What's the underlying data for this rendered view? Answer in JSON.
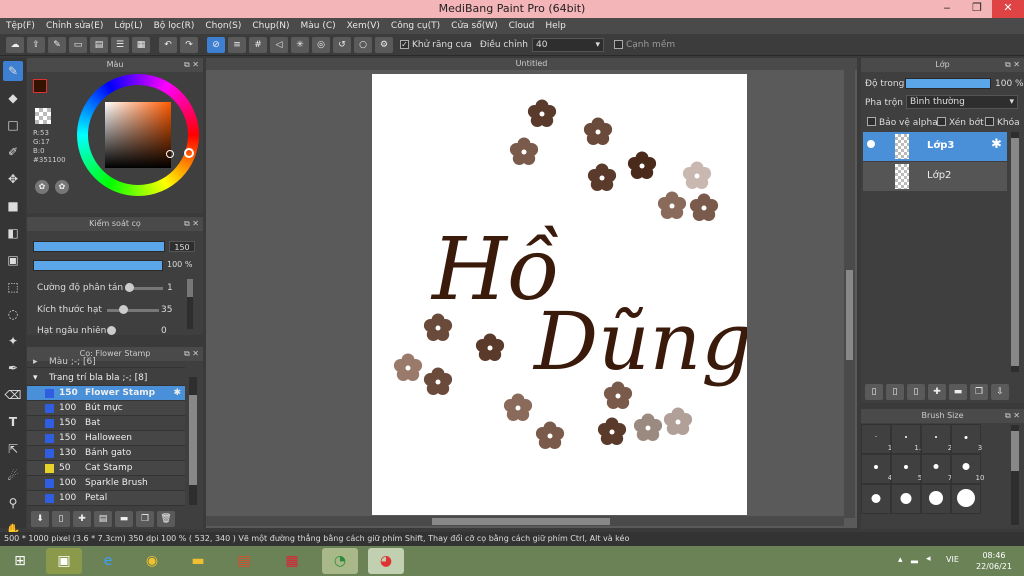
{
  "app": {
    "title": "MediBang Paint Pro (64bit)"
  },
  "menu": [
    "Tệp(F)",
    "Chỉnh sửa(E)",
    "Lớp(L)",
    "Bộ lọc(R)",
    "Chọn(S)",
    "Chụp(N)",
    "Màu (C)",
    "Xem(V)",
    "Công cụ(T)",
    "Cửa sổ(W)",
    "Cloud",
    "Help"
  ],
  "toolbar": {
    "antialias_label": "Khử răng cưa",
    "adjust_label": "Điều chỉnh",
    "adjust_value": "40",
    "edge_label": "Cạnh mềm"
  },
  "color_panel": {
    "title": "Màu",
    "r": "R:53",
    "g": "G:17",
    "b": "B:0",
    "hex": "#351100",
    "fg_color": "#351100",
    "bg_color": "#000000"
  },
  "brush_control": {
    "title": "Kiểm soát cọ",
    "size_value": "150",
    "opacity_value": "100 %",
    "scatter_label": "Cường độ phân tán",
    "scatter_value": "1",
    "particle_label": "Kích thước hạt",
    "particle_value": "35",
    "random_label": "Hạt ngẫu nhiên",
    "random_value": "0"
  },
  "brush_list": {
    "title": "Cọ: Flower Stamp",
    "groups": [
      "Màu ;-; [6]",
      "Trang trí bla bla ;-; [8]"
    ],
    "items": [
      {
        "size": "150",
        "name": "Flower Stamp",
        "color": "#2f5fe0",
        "selected": true
      },
      {
        "size": "100",
        "name": "Bút mực",
        "color": "#2f5fe0"
      },
      {
        "size": "150",
        "name": "Bat",
        "color": "#2f5fe0"
      },
      {
        "size": "150",
        "name": "Halloween",
        "color": "#2f5fe0"
      },
      {
        "size": "130",
        "name": "Bánh gato",
        "color": "#2f5fe0"
      },
      {
        "size": "50",
        "name": "Cat Stamp",
        "color": "#e6d22a"
      },
      {
        "size": "100",
        "name": "Sparkle Brush",
        "color": "#2f5fe0"
      },
      {
        "size": "100",
        "name": "Petal",
        "color": "#2f5fe0"
      }
    ]
  },
  "canvas": {
    "tab_title": "Untitled",
    "text_line1": "Hồ",
    "text_line2": "Dũng",
    "ink_color": "#3a1a0a"
  },
  "layer_panel": {
    "title": "Lớp",
    "opacity_label": "Độ trong",
    "opacity_value": "100 %",
    "blend_label": "Pha trộn",
    "blend_value": "Bình thường",
    "protect_alpha": "Bảo vệ alpha",
    "clip": "Xén bớt",
    "lock": "Khóa",
    "layers": [
      {
        "name": "Lớp3",
        "selected": true
      },
      {
        "name": "Lớp2",
        "selected": false
      }
    ]
  },
  "brush_size_panel": {
    "title": "Brush Size",
    "sizes": [
      "1",
      "1.5",
      "2",
      "3",
      "4",
      "5",
      "7",
      "10",
      "",
      "",
      "",
      ""
    ]
  },
  "status": {
    "text": "500 * 1000 pixel   (3.6 * 7.3cm)   350 dpi   100 %   ( 532, 340 )   Vẽ một đường thẳng bằng cách giữ phím Shift, Thay đổi cỡ cọ bằng cách giữ phím Ctrl, Alt và kéo"
  },
  "taskbar": {
    "lang": "VIE",
    "time": "08:46",
    "date": "22/06/21"
  }
}
